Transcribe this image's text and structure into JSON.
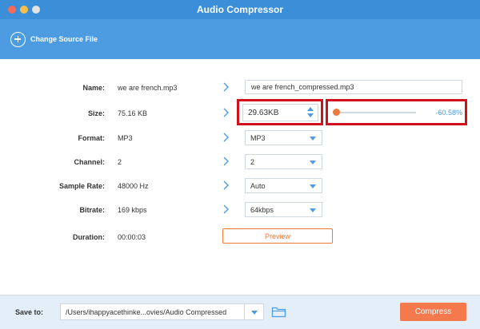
{
  "window": {
    "title": "Audio Compressor"
  },
  "toolbar": {
    "change_source_label": "Change Source File"
  },
  "form": {
    "name": {
      "label": "Name:",
      "source": "we are french.mp3",
      "output": "we are french_compressed.mp3"
    },
    "size": {
      "label": "Size:",
      "source": "75.16 KB",
      "output": "29.63KB",
      "percent": "-60.58%",
      "slider_fraction": 0
    },
    "format": {
      "label": "Format:",
      "source": "MP3",
      "output": "MP3"
    },
    "channel": {
      "label": "Channel:",
      "source": "2",
      "output": "2"
    },
    "sample_rate": {
      "label": "Sample Rate:",
      "source": "48000 Hz",
      "output": "Auto"
    },
    "bitrate": {
      "label": "Bitrate:",
      "source": "169 kbps",
      "output": "64kbps"
    },
    "duration": {
      "label": "Duration:",
      "source": "00:00:03"
    }
  },
  "preview_label": "Preview",
  "footer": {
    "save_to_label": "Save to:",
    "path": "/Users/ihappyacethinke...ovies/Audio Compressed",
    "compress_label": "Compress"
  },
  "icons": {
    "plus": "plus-circle-icon",
    "chevron": "chevron-right-icon",
    "spinner": "up-down-arrows-icon",
    "dropdown": "caret-down-icon",
    "folder": "folder-icon"
  },
  "colors": {
    "title_bar": "#3b8ed8",
    "toolbar": "#4d9be0",
    "accent_orange": "#f07a3c",
    "compress_button": "#f47a4d",
    "highlight_box": "#d0101c",
    "footer_bg": "#e4eef8"
  }
}
